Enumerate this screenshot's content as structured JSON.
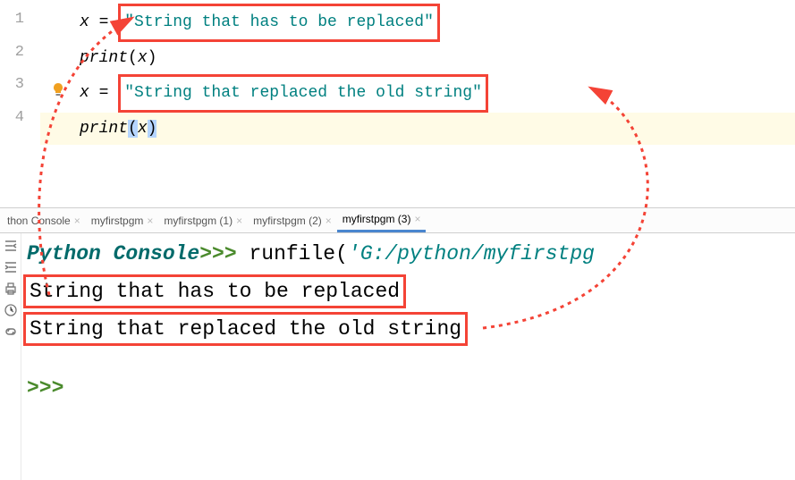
{
  "editor": {
    "lines": {
      "1": {
        "num": "1",
        "var": "x",
        "eq": " = ",
        "str": "\"String that has to be replaced\""
      },
      "2": {
        "num": "2",
        "call": "print",
        "open": "(",
        "arg": "x",
        "close": ")"
      },
      "3": {
        "num": "3",
        "var": "x",
        "eq": " = ",
        "str": "\"String that replaced the old string\""
      },
      "4": {
        "num": "4",
        "call": "print",
        "open": "(",
        "arg": "x",
        "close": ")"
      }
    }
  },
  "tabs": {
    "a": "thon Console",
    "b": "myfirstpgm",
    "c": "myfirstpgm (1)",
    "d": "myfirstpgm (2)",
    "e": "myfirstpgm (3)"
  },
  "console": {
    "title": "Python Console",
    "prompt1": ">>>",
    "run_fn": " runfile(",
    "run_arg": "'G:/python/myfirstpg",
    "out1": "String that has to be replaced",
    "out2": "String that replaced the old string",
    "prompt2": ">>>"
  }
}
